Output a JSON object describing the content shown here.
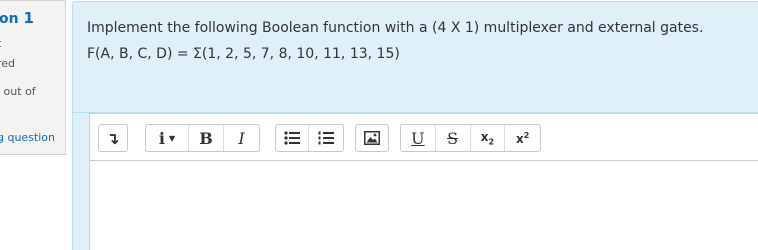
{
  "question_info": {
    "label": "on",
    "number": "1",
    "status_line1": "t",
    "status_line2": "red",
    "mark_line": "l out of",
    "flag_text": "g question"
  },
  "question": {
    "line1": "Implement the following Boolean function with a (4 X 1) multiplexer and external gates.",
    "line2": "F(A, B, C, D) = Σ(1, 2, 5, 7, 8, 10, 11, 13, 15)"
  },
  "toolbar": {
    "collapse_symbol": "↴",
    "info_symbol": "i",
    "info_caret": "▼",
    "bold_label": "B",
    "italic_label": "I",
    "underline_label": "U",
    "strike_label": "S",
    "subscript_base": "x",
    "subscript_mark": "2",
    "superscript_base": "x",
    "superscript_mark": "2"
  },
  "colors": {
    "accent": "#0f6cbf",
    "panel_bg": "#dff0f9",
    "panel_border": "#b9deef",
    "info_bg": "#f3f3f3"
  },
  "icons": {
    "collapse": "collapse-toolbar-icon",
    "unordered_list": "unordered-list-icon",
    "ordered_list": "ordered-list-icon",
    "image": "image-icon"
  }
}
